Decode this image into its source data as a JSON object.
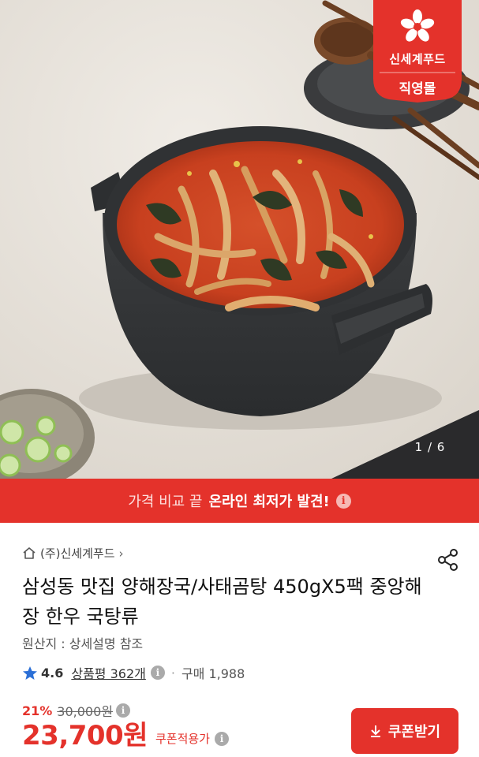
{
  "brand_badge": {
    "top_text": "신세계푸드",
    "bottom_text": "직영몰",
    "color": "#e4322b"
  },
  "image_counter": "1 / 6",
  "promo_banner": {
    "normal_text": "가격 비교 끝",
    "bold_text": "온라인 최저가 발견!",
    "info_icon": "i",
    "color": "#e4322b"
  },
  "product": {
    "store_name": "(주)신세계푸드",
    "title": "삼성동 맛집 양해장국/사태곰탕 450gX5팩 중앙해장 한우 국탕류",
    "origin": "원산지 : 상세설명 참조",
    "rating": "4.6",
    "reviews_label": "상품평 362개",
    "purchase_label": "구매 1,988",
    "discount_rate": "21%",
    "original_price": "30,000원",
    "sale_price": "23,700원",
    "coupon_applied_label": "쿠폰적용가",
    "info_icon": "i"
  },
  "coupon_button": {
    "label": "쿠폰받기"
  },
  "icons": {
    "home": "home-icon",
    "chevron": "chevron-right-icon",
    "share": "share-icon",
    "star": "star-icon",
    "download": "download-icon"
  },
  "colors": {
    "accent": "#e4322b",
    "star": "#2b6fd6"
  }
}
